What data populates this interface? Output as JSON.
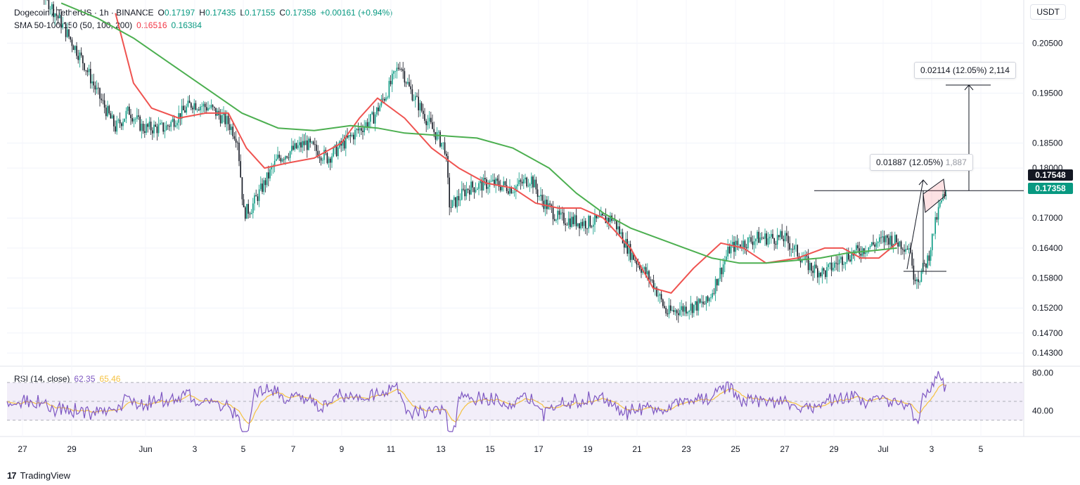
{
  "header": {
    "symbol": "Dogecoin / TetherUS · 1h · BINANCE",
    "o_label": "O",
    "o_value": "0.17197",
    "h_label": "H",
    "h_value": "0.17435",
    "l_label": "L",
    "l_value": "0.17155",
    "c_label": "C",
    "c_value": "0.17358",
    "change": "+0.00161 (+0.94%)"
  },
  "sma_legend": {
    "label": "SMA 50-100-150 (50, 100, 200)",
    "v1": "0.16516",
    "v2": "0.16384"
  },
  "rsi_legend": {
    "label": "RSI (14, close)",
    "v1": "62.35",
    "v2": "65.46"
  },
  "currency": "USDT",
  "price_tags": {
    "high_line": "0.17548",
    "last": "0.17358"
  },
  "measurements": {
    "upper": "0.02114 (12.05%) 2,114",
    "lower_main": "0.01887 (12.05%)",
    "lower_dim": "1,887"
  },
  "brand": "TradingView",
  "colors": {
    "up": "#089981",
    "down": "#131722",
    "sma_fast": "#f23645",
    "sma_slow": "#089981",
    "sma_red_line": "#ef5350",
    "sma_green_line": "#4caf50",
    "rsi": "#7e57c2",
    "rsi_ma": "#f5c242",
    "rsi_band": "#ede7f6"
  },
  "chart_data": {
    "type": "candlestick",
    "price_axis": {
      "ticks": [
        "0.20500",
        "0.19500",
        "0.18500",
        "0.18000",
        "0.17000",
        "0.16400",
        "0.15800",
        "0.15200",
        "0.14700",
        "0.14300"
      ],
      "ylim": [
        0.1405,
        0.208
      ]
    },
    "rsi_axis": {
      "ticks": [
        "80.00",
        "40.00"
      ],
      "ylim": [
        15,
        85
      ],
      "band": [
        30,
        70
      ]
    },
    "x_axis": {
      "ticks": [
        "27",
        "29",
        "Jun",
        "3",
        "5",
        "7",
        "9",
        "11",
        "13",
        "15",
        "17",
        "19",
        "21",
        "23",
        "25",
        "27",
        "29",
        "Jul",
        "3",
        "5"
      ]
    },
    "price_path": [
      [
        0,
        0.218
      ],
      [
        0.04,
        0.215
      ],
      [
        0.06,
        0.209
      ],
      [
        0.085,
        0.201
      ],
      [
        0.1,
        0.195
      ],
      [
        0.12,
        0.188
      ],
      [
        0.135,
        0.1915
      ],
      [
        0.15,
        0.188
      ],
      [
        0.175,
        0.188
      ],
      [
        0.205,
        0.193
      ],
      [
        0.225,
        0.192
      ],
      [
        0.245,
        0.189
      ],
      [
        0.255,
        0.186
      ],
      [
        0.262,
        0.171
      ],
      [
        0.27,
        0.172
      ],
      [
        0.3,
        0.182
      ],
      [
        0.33,
        0.185
      ],
      [
        0.355,
        0.182
      ],
      [
        0.385,
        0.187
      ],
      [
        0.405,
        0.19
      ],
      [
        0.42,
        0.195
      ],
      [
        0.435,
        0.201
      ],
      [
        0.445,
        0.196
      ],
      [
        0.47,
        0.188
      ],
      [
        0.485,
        0.184
      ],
      [
        0.49,
        0.172
      ],
      [
        0.51,
        0.176
      ],
      [
        0.535,
        0.177
      ],
      [
        0.56,
        0.176
      ],
      [
        0.58,
        0.178
      ],
      [
        0.59,
        0.174
      ],
      [
        0.61,
        0.17
      ],
      [
        0.64,
        0.169
      ],
      [
        0.67,
        0.17
      ],
      [
        0.69,
        0.163
      ],
      [
        0.715,
        0.157
      ],
      [
        0.73,
        0.151
      ],
      [
        0.75,
        0.152
      ],
      [
        0.775,
        0.153
      ],
      [
        0.8,
        0.164
      ],
      [
        0.83,
        0.166
      ],
      [
        0.86,
        0.166
      ],
      [
        0.89,
        0.16
      ],
      [
        0.905,
        0.159
      ],
      [
        0.925,
        0.162
      ],
      [
        0.95,
        0.164
      ],
      [
        0.975,
        0.166
      ],
      [
        1,
        0.164
      ]
    ],
    "price_path_note": "x is the fraction of the shown time span",
    "tail_path": [
      [
        0,
        0.164
      ],
      [
        0.15,
        0.166
      ],
      [
        0.3,
        0.162
      ],
      [
        0.45,
        0.159
      ],
      [
        0.55,
        0.158
      ],
      [
        0.7,
        0.162
      ],
      [
        0.8,
        0.168
      ],
      [
        0.88,
        0.172
      ],
      [
        0.94,
        0.174
      ],
      [
        1,
        0.1736
      ]
    ],
    "series": [
      {
        "name": "SMA 50",
        "type": "line",
        "points": [
          [
            0.12,
            0.211
          ],
          [
            0.14,
            0.197
          ],
          [
            0.16,
            0.192
          ],
          [
            0.19,
            0.19
          ],
          [
            0.22,
            0.191
          ],
          [
            0.245,
            0.191
          ],
          [
            0.265,
            0.184
          ],
          [
            0.285,
            0.18
          ],
          [
            0.31,
            0.181
          ],
          [
            0.34,
            0.182
          ],
          [
            0.37,
            0.185
          ],
          [
            0.39,
            0.19
          ],
          [
            0.41,
            0.194
          ],
          [
            0.44,
            0.19
          ],
          [
            0.47,
            0.184
          ],
          [
            0.5,
            0.18
          ],
          [
            0.53,
            0.177
          ],
          [
            0.56,
            0.176
          ],
          [
            0.585,
            0.173
          ],
          [
            0.61,
            0.172
          ],
          [
            0.635,
            0.172
          ],
          [
            0.66,
            0.17
          ],
          [
            0.69,
            0.164
          ],
          [
            0.715,
            0.156
          ],
          [
            0.735,
            0.155
          ],
          [
            0.76,
            0.16
          ],
          [
            0.79,
            0.165
          ],
          [
            0.815,
            0.164
          ],
          [
            0.84,
            0.161
          ],
          [
            0.875,
            0.162
          ],
          [
            0.905,
            0.164
          ],
          [
            0.925,
            0.164
          ],
          [
            0.945,
            0.162
          ],
          [
            0.965,
            0.162
          ],
          [
            0.985,
            0.165
          ]
        ]
      },
      {
        "name": "SMA 200",
        "type": "line",
        "points": [
          [
            0.06,
            0.213
          ],
          [
            0.1,
            0.21
          ],
          [
            0.14,
            0.206
          ],
          [
            0.18,
            0.201
          ],
          [
            0.22,
            0.196
          ],
          [
            0.26,
            0.191
          ],
          [
            0.3,
            0.188
          ],
          [
            0.34,
            0.1875
          ],
          [
            0.38,
            0.1885
          ],
          [
            0.41,
            0.188
          ],
          [
            0.44,
            0.187
          ],
          [
            0.48,
            0.1865
          ],
          [
            0.52,
            0.186
          ],
          [
            0.56,
            0.184
          ],
          [
            0.6,
            0.18
          ],
          [
            0.63,
            0.175
          ],
          [
            0.66,
            0.171
          ],
          [
            0.69,
            0.168
          ],
          [
            0.72,
            0.166
          ],
          [
            0.75,
            0.164
          ],
          [
            0.78,
            0.162
          ],
          [
            0.81,
            0.161
          ],
          [
            0.84,
            0.161
          ],
          [
            0.87,
            0.1615
          ],
          [
            0.9,
            0.162
          ],
          [
            0.93,
            0.163
          ],
          [
            0.96,
            0.1635
          ],
          [
            0.985,
            0.164
          ]
        ]
      }
    ],
    "rsi_series": {
      "name": "RSI",
      "ma_name": "RSI MA"
    }
  }
}
